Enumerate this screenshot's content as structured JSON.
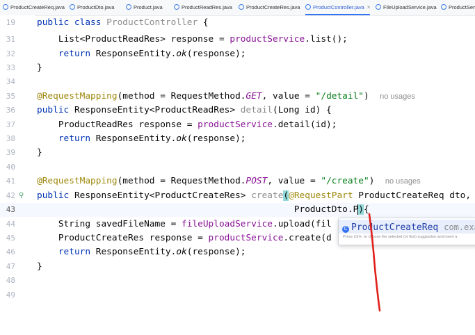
{
  "tabs": [
    {
      "label": "ProductCreateReq.java",
      "active": false
    },
    {
      "label": "ProductDto.java",
      "active": false
    },
    {
      "label": "Product.java",
      "active": false
    },
    {
      "label": "ProductReadRes.java",
      "active": false
    },
    {
      "label": "ProductCreateRes.java",
      "active": false
    },
    {
      "label": "ProductController.java",
      "active": true
    },
    {
      "label": "FileUploadService.java",
      "active": false
    },
    {
      "label": "ProductServi",
      "active": false
    }
  ],
  "tab_close_glyph": "×",
  "lines": {
    "l19": {
      "num": "19"
    },
    "l31": {
      "num": "31"
    },
    "l32": {
      "num": "32"
    },
    "l33": {
      "num": "33"
    },
    "l34": {
      "num": "34"
    },
    "l35": {
      "num": "35",
      "hint": "no usages"
    },
    "l36": {
      "num": "36"
    },
    "l37": {
      "num": "37"
    },
    "l38": {
      "num": "38"
    },
    "l39": {
      "num": "39"
    },
    "l40": {
      "num": "40"
    },
    "l41": {
      "num": "41",
      "hint": "no usages"
    },
    "l42": {
      "num": "42"
    },
    "l43": {
      "num": "43"
    },
    "l44": {
      "num": "44"
    },
    "l45": {
      "num": "45"
    },
    "l46": {
      "num": "46"
    },
    "l47": {
      "num": "47"
    },
    "l48": {
      "num": "48"
    },
    "l49": {
      "num": "49"
    }
  },
  "completion": {
    "icon_letter": "C",
    "item": "ProductCreateReq",
    "package": "com.exa",
    "footer": "Press Ctrl+. to choose the selected (or first) suggestion and insert a"
  },
  "colors": {
    "keyword": "#0033b3",
    "annotation": "#9e880d",
    "method": "#00627a",
    "field": "#871094",
    "string": "#067d17",
    "annotation_stroke": "#e0211b"
  }
}
